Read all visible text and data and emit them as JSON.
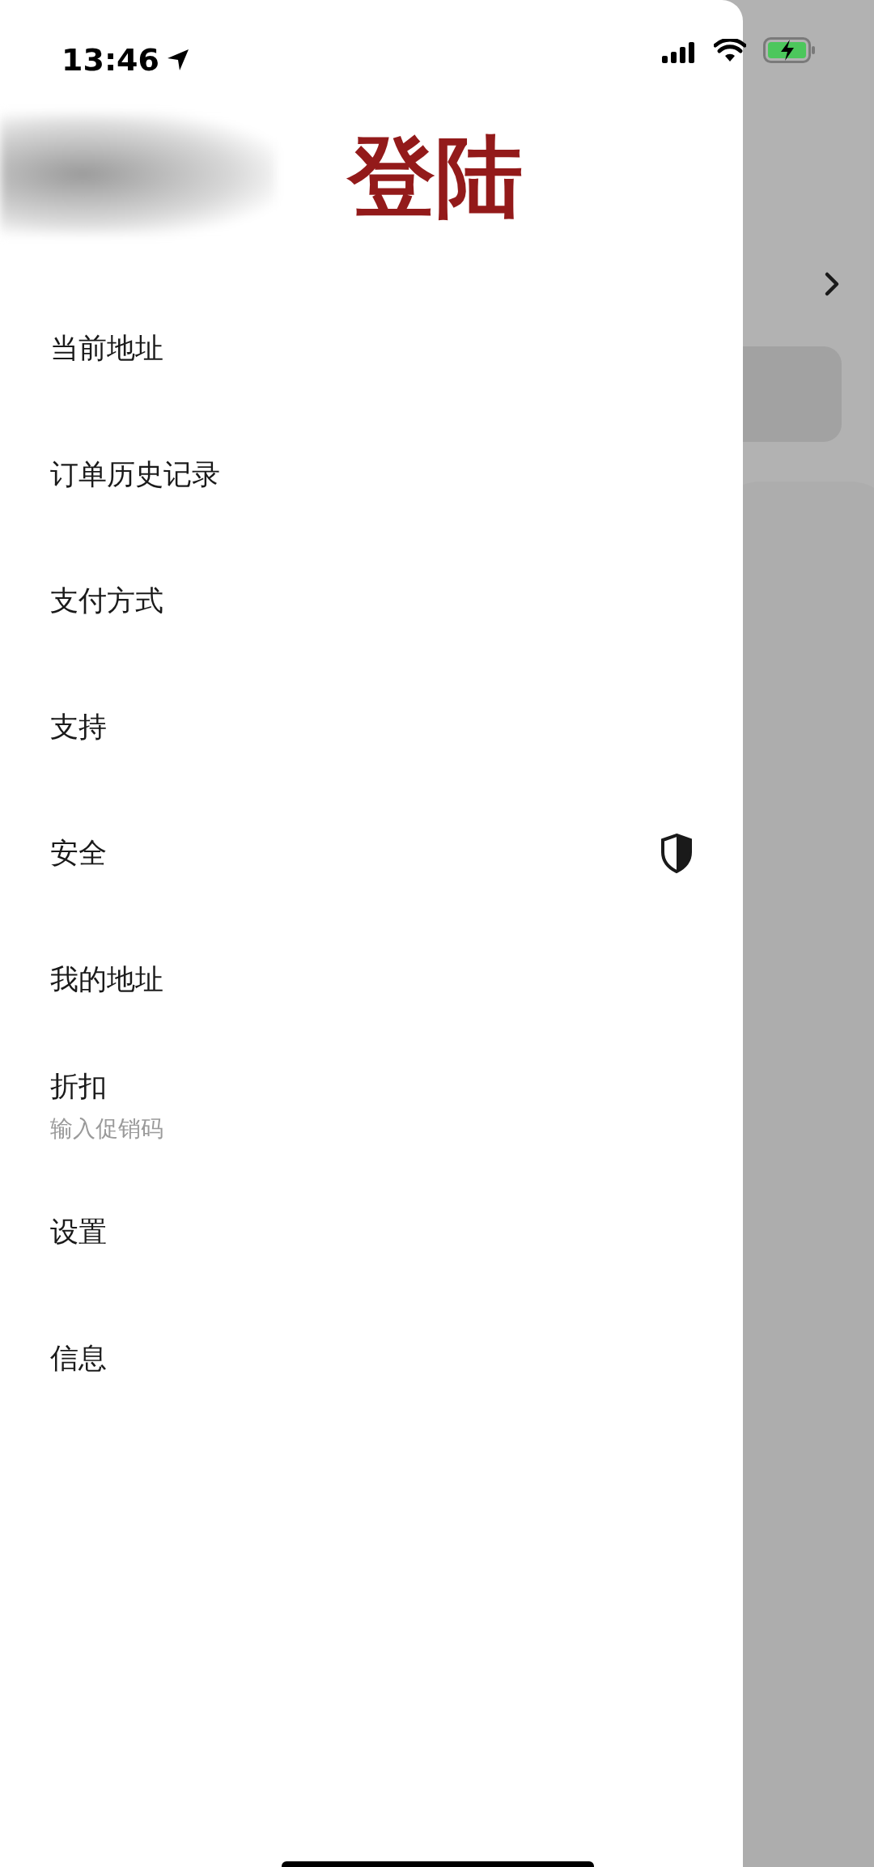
{
  "status_bar": {
    "time": "13:46"
  },
  "header": {
    "title": "登陆"
  },
  "menu": [
    {
      "kind": "plain",
      "label": "当前地址"
    },
    {
      "kind": "plain",
      "label": "订单历史记录"
    },
    {
      "kind": "plain",
      "label": "支付方式"
    },
    {
      "kind": "plain",
      "label": "支持"
    },
    {
      "kind": "icon",
      "label": "安全"
    },
    {
      "kind": "plain",
      "label": "我的地址"
    },
    {
      "kind": "subtitle",
      "label": "折扣",
      "subtitle": "输入促销码"
    },
    {
      "kind": "plain",
      "label": "设置"
    },
    {
      "kind": "plain",
      "label": "信息"
    }
  ]
}
